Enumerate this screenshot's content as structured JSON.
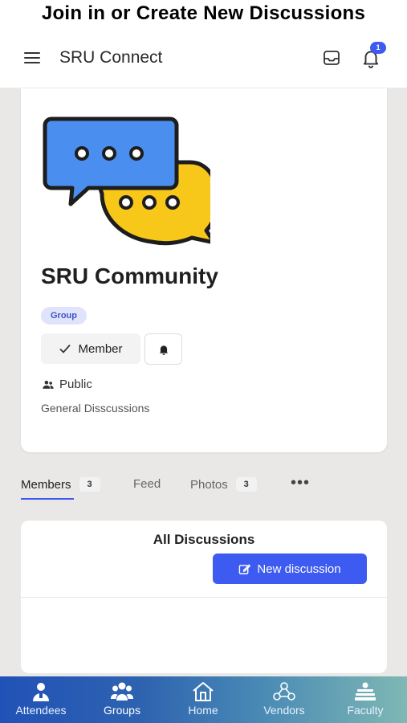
{
  "caption": "Join in or Create New Discussions",
  "appbar": {
    "title": "SRU Connect",
    "notification_count": "1"
  },
  "group": {
    "name": "SRU Community",
    "tag": "Group",
    "member_label": "Member",
    "privacy": "Public",
    "description": "General Disscussions"
  },
  "tabs": [
    {
      "label": "Members",
      "count": "3"
    },
    {
      "label": "Feed"
    },
    {
      "label": "Photos",
      "count": "3"
    }
  ],
  "discussions": {
    "title": "All Discussions",
    "new_button": "New discussion"
  },
  "bottom_nav": [
    {
      "label": "Attendees",
      "icon": "attendees-icon"
    },
    {
      "label": "Groups",
      "icon": "groups-icon"
    },
    {
      "label": "Home",
      "icon": "home-icon"
    },
    {
      "label": "Vendors",
      "icon": "vendors-icon"
    },
    {
      "label": "Faculty",
      "icon": "faculty-icon"
    }
  ],
  "colors": {
    "accent": "#3d5af1",
    "chat_blue": "#4a8ff0",
    "chat_yellow": "#f7c81a"
  }
}
